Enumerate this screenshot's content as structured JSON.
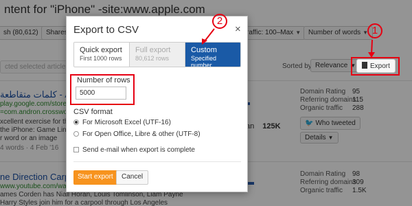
{
  "background": {
    "title": "ntent for \"iPhone\" -site:www.apple.com",
    "filters": [
      {
        "label": "sh (80,612)"
      },
      {
        "label": "Shares"
      },
      {
        "label": "raffic: 100–Max"
      },
      {
        "label": "Number of words"
      }
    ],
    "toolbar": {
      "selected_articles": "cted selected articles",
      "sorted_by": "Sorted by",
      "sort_value": "Relevance",
      "export_label": "Export"
    },
    "results": [
      {
        "title": "كلمات متقاطعة - Apps on",
        "url": "play.google.com/store/ap",
        "url2": "=com.andron.crosswords",
        "snippet1": "xcellent exercise for the",
        "snippet2": "the iPhone: Game Link",
        "snippet3": "r word or an image",
        "meta": "4 words   ·   4 Feb '16",
        "mid_text": "an",
        "mid_value": "125K",
        "metrics": [
          {
            "label": "Domain Rating",
            "value": "95"
          },
          {
            "label": "Referring domains",
            "value": "115"
          },
          {
            "label": "Organic traffic",
            "value": "288"
          }
        ],
        "tweet_label": "Who tweeted",
        "details_label": "Details"
      },
      {
        "title": "ne Direction Carpo",
        "url": "www.youtube.com/watch",
        "snippet1": "ames Corden has Niall Horan, Louis Tomlinson, Liam Payne",
        "snippet2": "Harry Styles join him for a carpool through Los Angeles",
        "metrics": [
          {
            "label": "Domain Rating",
            "value": "98"
          },
          {
            "label": "Referring domains",
            "value": "309"
          },
          {
            "label": "Organic traffic",
            "value": "1.5K"
          }
        ]
      }
    ]
  },
  "modal": {
    "title": "Export to CSV",
    "close": "×",
    "tabs": [
      {
        "line1": "Quick export",
        "line2": "First 1000 rows"
      },
      {
        "line1": "Full export",
        "line2": "80,612 rows"
      },
      {
        "line1": "Custom",
        "line2": "Specified number"
      }
    ],
    "rows_label": "Number of rows",
    "rows_value": "5000",
    "format_title": "CSV format",
    "format_options": [
      {
        "label": "For Microsoft Excel (UTF-16)",
        "selected": true
      },
      {
        "label": "For Open Office, Libre & other (UTF-8)",
        "selected": false
      }
    ],
    "email_option": "Send e-mail when export is complete",
    "start_button": "Start export",
    "cancel_button": "Cancel"
  },
  "annotations": {
    "step1": "1",
    "step2": "2",
    "color": "#e60012"
  }
}
